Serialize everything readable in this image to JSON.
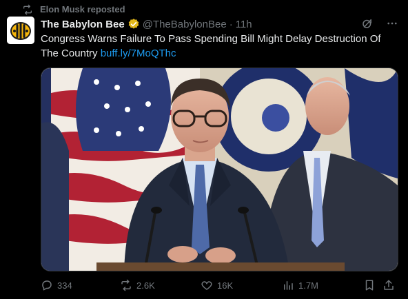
{
  "repost": {
    "text": "Elon Musk reposted",
    "icon": "repost-icon"
  },
  "tweet": {
    "author_name": "The Babylon Bee",
    "handle": "@TheBabylonBee",
    "separator": "·",
    "time": "11h",
    "text": "Congress Warns Failure To Pass Spending Bill Might Delay Destruction Of The Country",
    "link": "buff.ly/7MoQThc",
    "verified": true,
    "verified_color": "#e2b719"
  },
  "header_icons": [
    "grok-icon",
    "more-icon"
  ],
  "media": {
    "alt": "photo of two men in suits at a press podium in front of American flags and a House seal"
  },
  "actions": {
    "replies": "334",
    "reposts": "2.6K",
    "likes": "16K",
    "views": "1.7M"
  },
  "colors": {
    "accent": "#1d9bf0",
    "muted": "#71767b",
    "text": "#e7e9ea",
    "background": "#000000"
  }
}
